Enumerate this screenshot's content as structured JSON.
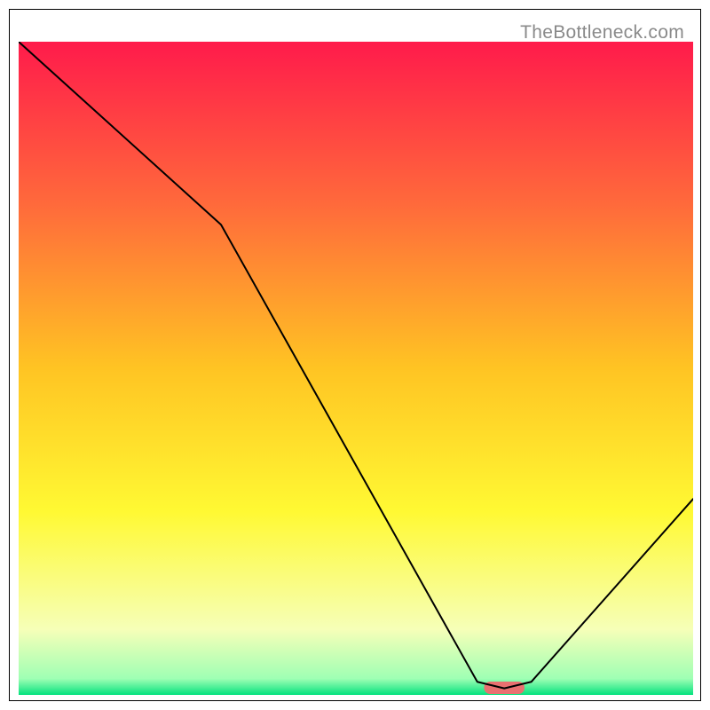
{
  "watermark": "TheBottleneck.com",
  "chart_data": {
    "type": "line",
    "title": "",
    "xlabel": "",
    "ylabel": "",
    "xlim": [
      0,
      100
    ],
    "ylim": [
      0,
      100
    ],
    "x": [
      0,
      30,
      68,
      72,
      76,
      100
    ],
    "values": [
      100,
      72,
      2,
      1,
      2,
      30
    ],
    "annotations": [
      {
        "kind": "marker",
        "shape": "rounded-rect",
        "x": 72,
        "width": 6,
        "color": "#e97070"
      }
    ],
    "gradient_stops": [
      {
        "t": 0.0,
        "color": "#ff1b4b"
      },
      {
        "t": 0.25,
        "color": "#ff6a3b"
      },
      {
        "t": 0.5,
        "color": "#ffc423"
      },
      {
        "t": 0.72,
        "color": "#fff933"
      },
      {
        "t": 0.9,
        "color": "#f6ffb8"
      },
      {
        "t": 0.975,
        "color": "#9fffb4"
      },
      {
        "t": 1.0,
        "color": "#04e27e"
      }
    ],
    "curve_style": {
      "stroke": "#000000",
      "width": 2
    }
  }
}
